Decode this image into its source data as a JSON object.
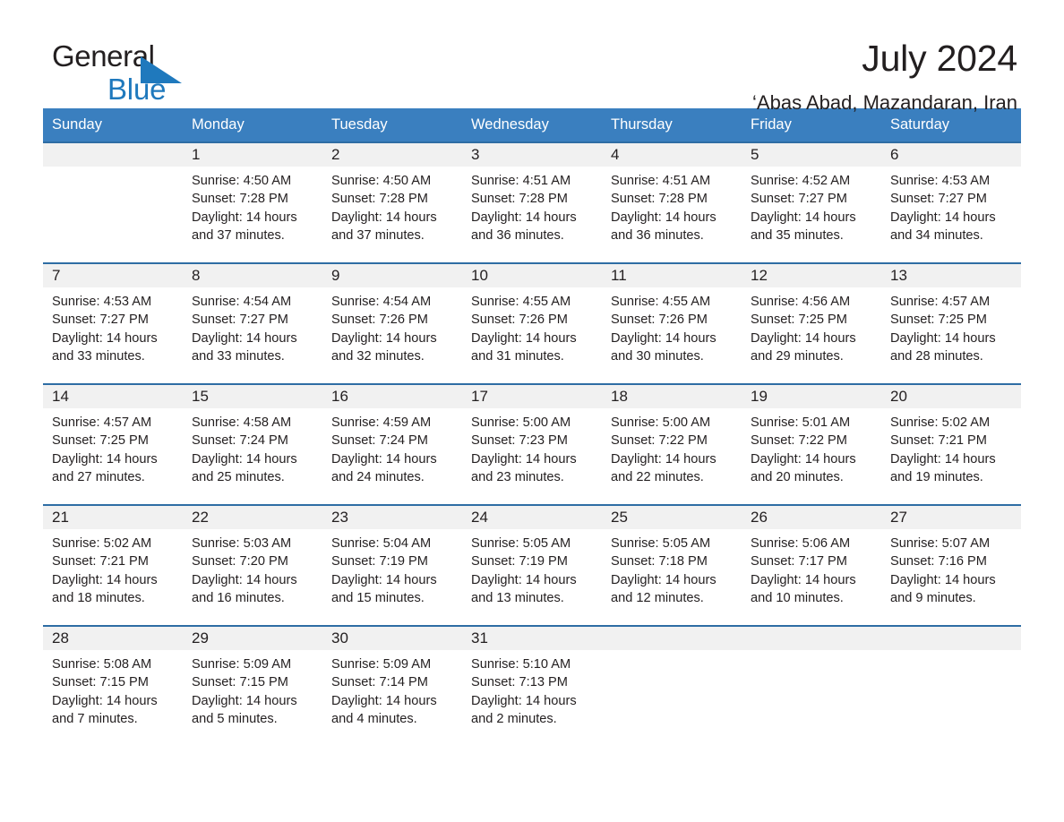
{
  "brand": {
    "name_part1": "General",
    "name_part2": "Blue",
    "accent_color": "#1f79bd",
    "triangle_icon": "brand-triangle-icon"
  },
  "header": {
    "title": "July 2024",
    "subtitle": "‘Abas Abad, Mazandaran, Iran"
  },
  "colors": {
    "header_row_bg": "#3a7fbf",
    "row_top_border": "#2e6da4",
    "daynum_band_bg": "#f1f1f1",
    "text": "#231f20"
  },
  "weekday_headers": [
    "Sunday",
    "Monday",
    "Tuesday",
    "Wednesday",
    "Thursday",
    "Friday",
    "Saturday"
  ],
  "labels": {
    "sunrise_prefix": "Sunrise:",
    "sunset_prefix": "Sunset:",
    "daylight_prefix": "Daylight:"
  },
  "weeks": [
    [
      {
        "day": "",
        "empty": true,
        "line1": "",
        "line2": "",
        "line3": "",
        "line4": ""
      },
      {
        "day": "1",
        "empty": false,
        "line1": "Sunrise: 4:50 AM",
        "line2": "Sunset: 7:28 PM",
        "line3": "Daylight: 14 hours",
        "line4": "and 37 minutes."
      },
      {
        "day": "2",
        "empty": false,
        "line1": "Sunrise: 4:50 AM",
        "line2": "Sunset: 7:28 PM",
        "line3": "Daylight: 14 hours",
        "line4": "and 37 minutes."
      },
      {
        "day": "3",
        "empty": false,
        "line1": "Sunrise: 4:51 AM",
        "line2": "Sunset: 7:28 PM",
        "line3": "Daylight: 14 hours",
        "line4": "and 36 minutes."
      },
      {
        "day": "4",
        "empty": false,
        "line1": "Sunrise: 4:51 AM",
        "line2": "Sunset: 7:28 PM",
        "line3": "Daylight: 14 hours",
        "line4": "and 36 minutes."
      },
      {
        "day": "5",
        "empty": false,
        "line1": "Sunrise: 4:52 AM",
        "line2": "Sunset: 7:27 PM",
        "line3": "Daylight: 14 hours",
        "line4": "and 35 minutes."
      },
      {
        "day": "6",
        "empty": false,
        "line1": "Sunrise: 4:53 AM",
        "line2": "Sunset: 7:27 PM",
        "line3": "Daylight: 14 hours",
        "line4": "and 34 minutes."
      }
    ],
    [
      {
        "day": "7",
        "empty": false,
        "line1": "Sunrise: 4:53 AM",
        "line2": "Sunset: 7:27 PM",
        "line3": "Daylight: 14 hours",
        "line4": "and 33 minutes."
      },
      {
        "day": "8",
        "empty": false,
        "line1": "Sunrise: 4:54 AM",
        "line2": "Sunset: 7:27 PM",
        "line3": "Daylight: 14 hours",
        "line4": "and 33 minutes."
      },
      {
        "day": "9",
        "empty": false,
        "line1": "Sunrise: 4:54 AM",
        "line2": "Sunset: 7:26 PM",
        "line3": "Daylight: 14 hours",
        "line4": "and 32 minutes."
      },
      {
        "day": "10",
        "empty": false,
        "line1": "Sunrise: 4:55 AM",
        "line2": "Sunset: 7:26 PM",
        "line3": "Daylight: 14 hours",
        "line4": "and 31 minutes."
      },
      {
        "day": "11",
        "empty": false,
        "line1": "Sunrise: 4:55 AM",
        "line2": "Sunset: 7:26 PM",
        "line3": "Daylight: 14 hours",
        "line4": "and 30 minutes."
      },
      {
        "day": "12",
        "empty": false,
        "line1": "Sunrise: 4:56 AM",
        "line2": "Sunset: 7:25 PM",
        "line3": "Daylight: 14 hours",
        "line4": "and 29 minutes."
      },
      {
        "day": "13",
        "empty": false,
        "line1": "Sunrise: 4:57 AM",
        "line2": "Sunset: 7:25 PM",
        "line3": "Daylight: 14 hours",
        "line4": "and 28 minutes."
      }
    ],
    [
      {
        "day": "14",
        "empty": false,
        "line1": "Sunrise: 4:57 AM",
        "line2": "Sunset: 7:25 PM",
        "line3": "Daylight: 14 hours",
        "line4": "and 27 minutes."
      },
      {
        "day": "15",
        "empty": false,
        "line1": "Sunrise: 4:58 AM",
        "line2": "Sunset: 7:24 PM",
        "line3": "Daylight: 14 hours",
        "line4": "and 25 minutes."
      },
      {
        "day": "16",
        "empty": false,
        "line1": "Sunrise: 4:59 AM",
        "line2": "Sunset: 7:24 PM",
        "line3": "Daylight: 14 hours",
        "line4": "and 24 minutes."
      },
      {
        "day": "17",
        "empty": false,
        "line1": "Sunrise: 5:00 AM",
        "line2": "Sunset: 7:23 PM",
        "line3": "Daylight: 14 hours",
        "line4": "and 23 minutes."
      },
      {
        "day": "18",
        "empty": false,
        "line1": "Sunrise: 5:00 AM",
        "line2": "Sunset: 7:22 PM",
        "line3": "Daylight: 14 hours",
        "line4": "and 22 minutes."
      },
      {
        "day": "19",
        "empty": false,
        "line1": "Sunrise: 5:01 AM",
        "line2": "Sunset: 7:22 PM",
        "line3": "Daylight: 14 hours",
        "line4": "and 20 minutes."
      },
      {
        "day": "20",
        "empty": false,
        "line1": "Sunrise: 5:02 AM",
        "line2": "Sunset: 7:21 PM",
        "line3": "Daylight: 14 hours",
        "line4": "and 19 minutes."
      }
    ],
    [
      {
        "day": "21",
        "empty": false,
        "line1": "Sunrise: 5:02 AM",
        "line2": "Sunset: 7:21 PM",
        "line3": "Daylight: 14 hours",
        "line4": "and 18 minutes."
      },
      {
        "day": "22",
        "empty": false,
        "line1": "Sunrise: 5:03 AM",
        "line2": "Sunset: 7:20 PM",
        "line3": "Daylight: 14 hours",
        "line4": "and 16 minutes."
      },
      {
        "day": "23",
        "empty": false,
        "line1": "Sunrise: 5:04 AM",
        "line2": "Sunset: 7:19 PM",
        "line3": "Daylight: 14 hours",
        "line4": "and 15 minutes."
      },
      {
        "day": "24",
        "empty": false,
        "line1": "Sunrise: 5:05 AM",
        "line2": "Sunset: 7:19 PM",
        "line3": "Daylight: 14 hours",
        "line4": "and 13 minutes."
      },
      {
        "day": "25",
        "empty": false,
        "line1": "Sunrise: 5:05 AM",
        "line2": "Sunset: 7:18 PM",
        "line3": "Daylight: 14 hours",
        "line4": "and 12 minutes."
      },
      {
        "day": "26",
        "empty": false,
        "line1": "Sunrise: 5:06 AM",
        "line2": "Sunset: 7:17 PM",
        "line3": "Daylight: 14 hours",
        "line4": "and 10 minutes."
      },
      {
        "day": "27",
        "empty": false,
        "line1": "Sunrise: 5:07 AM",
        "line2": "Sunset: 7:16 PM",
        "line3": "Daylight: 14 hours",
        "line4": "and 9 minutes."
      }
    ],
    [
      {
        "day": "28",
        "empty": false,
        "line1": "Sunrise: 5:08 AM",
        "line2": "Sunset: 7:15 PM",
        "line3": "Daylight: 14 hours",
        "line4": "and 7 minutes."
      },
      {
        "day": "29",
        "empty": false,
        "line1": "Sunrise: 5:09 AM",
        "line2": "Sunset: 7:15 PM",
        "line3": "Daylight: 14 hours",
        "line4": "and 5 minutes."
      },
      {
        "day": "30",
        "empty": false,
        "line1": "Sunrise: 5:09 AM",
        "line2": "Sunset: 7:14 PM",
        "line3": "Daylight: 14 hours",
        "line4": "and 4 minutes."
      },
      {
        "day": "31",
        "empty": false,
        "line1": "Sunrise: 5:10 AM",
        "line2": "Sunset: 7:13 PM",
        "line3": "Daylight: 14 hours",
        "line4": "and 2 minutes."
      },
      {
        "day": "",
        "empty": true,
        "line1": "",
        "line2": "",
        "line3": "",
        "line4": ""
      },
      {
        "day": "",
        "empty": true,
        "line1": "",
        "line2": "",
        "line3": "",
        "line4": ""
      },
      {
        "day": "",
        "empty": true,
        "line1": "",
        "line2": "",
        "line3": "",
        "line4": ""
      }
    ]
  ]
}
